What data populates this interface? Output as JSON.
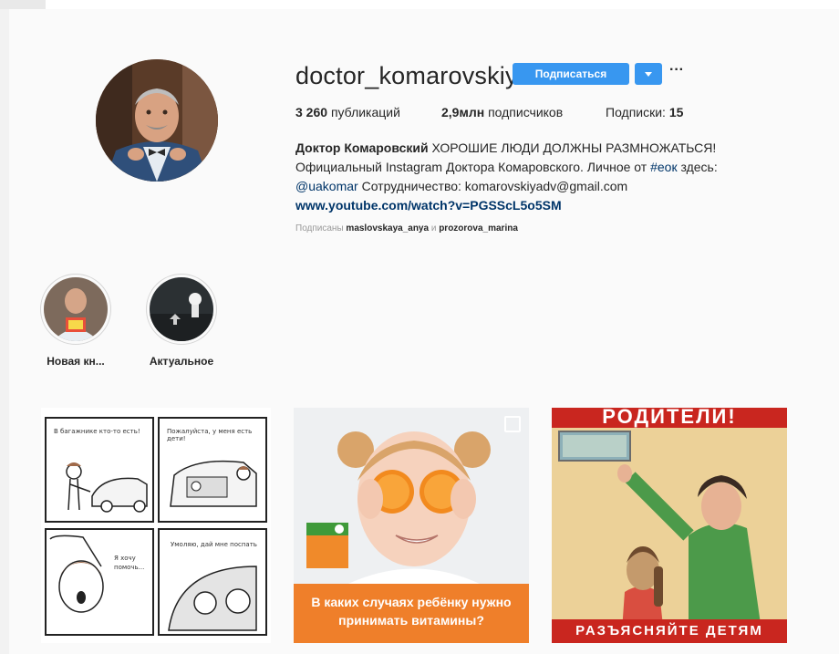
{
  "profile": {
    "username": "doctor_komarovskiy",
    "follow_label": "Подписаться",
    "more_label": "···"
  },
  "stats": {
    "posts_count": "3 260",
    "posts_label": "публикаций",
    "followers_count": "2,9млн",
    "followers_label": "подписчиков",
    "following_label": "Подписки:",
    "following_count": "15"
  },
  "bio": {
    "name": "Доктор Комаровский",
    "tagline": "ХОРОШИЕ ЛЮДИ ДОЛЖНЫ РАЗМНОЖАТЬСЯ!",
    "line2_prefix": "Официальный Instagram Доктора Комаровского. Личное от",
    "line2_tag": "#еок",
    "line2_suffix": "здесь:",
    "mention": "@uakomar",
    "line3_rest": "Сотрудничество: komarovskiyadv@gmail.com",
    "url": "www.youtube.com/watch?v=PGSScL5o5SM"
  },
  "followed_by": {
    "prefix": "Подписаны",
    "user1": "maslovskaya_anya",
    "and": "и",
    "user2": "prozorova_marina"
  },
  "highlights": [
    {
      "label": "Новая кн...",
      "icon": "book-cover-thumbnail"
    },
    {
      "label": "Актуальное",
      "icon": "car-sticker-thumbnail"
    }
  ],
  "posts": [
    {
      "type": "comic",
      "panels": [
        "В багажнике кто-то есть!",
        "Пожалуйста, у меня есть дети!",
        "Я хочу помочь...",
        "Умоляю, дай мне поспать"
      ]
    },
    {
      "type": "photo",
      "caption_line1": "В каких случаях ребёнку нужно",
      "caption_line2": "принимать витамины?",
      "multi_icon": "carousel-icon"
    },
    {
      "type": "poster",
      "top_text": "РОДИТЕЛИ!",
      "bottom_text": "РАЗЪЯСНЯЙТЕ ДЕТЯМ"
    }
  ],
  "colors": {
    "accent": "#3897f0",
    "link": "#003569",
    "background": "#fafafa",
    "orange": "#ef7f2a",
    "poster_red": "#c9261f"
  }
}
